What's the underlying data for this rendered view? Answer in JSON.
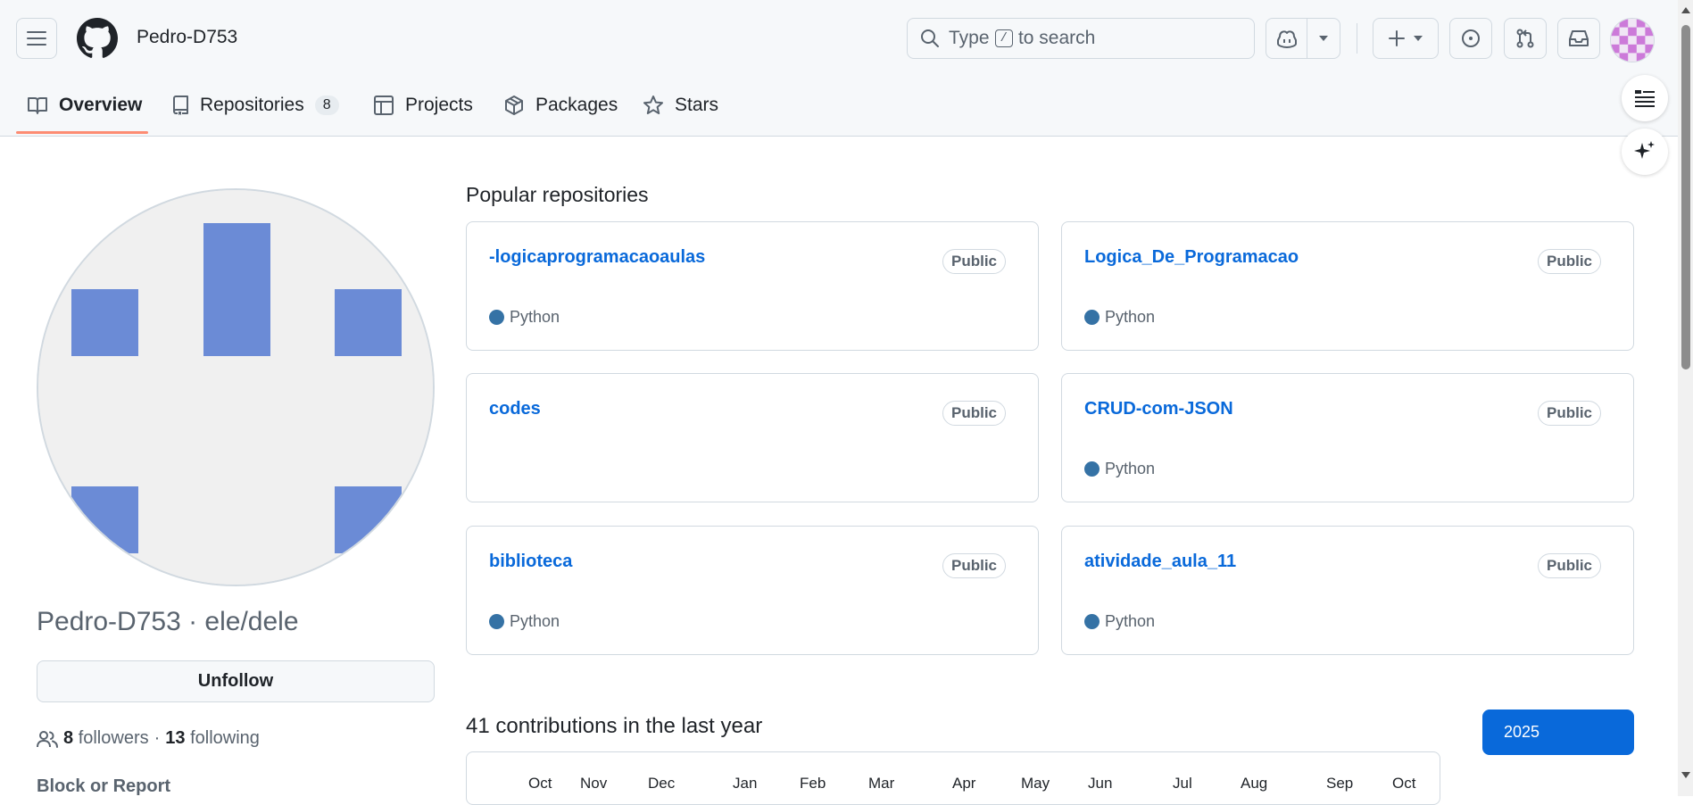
{
  "header": {
    "username": "Pedro-D753",
    "search": {
      "prefix": "Type",
      "key": "/",
      "suffix": "to search"
    }
  },
  "tabs": [
    {
      "label": "Overview",
      "icon": "book-icon",
      "active": true
    },
    {
      "label": "Repositories",
      "icon": "repo-icon",
      "count": "8"
    },
    {
      "label": "Projects",
      "icon": "table-icon"
    },
    {
      "label": "Packages",
      "icon": "package-icon"
    },
    {
      "label": "Stars",
      "icon": "star-icon"
    }
  ],
  "profile": {
    "name_line": "Pedro-D753 · ele/dele",
    "unfollow_label": "Unfollow",
    "followers_count": "8",
    "followers_label": "followers",
    "separator": "·",
    "following_count": "13",
    "following_label": "following",
    "block_report": "Block or Report"
  },
  "popular": {
    "title": "Popular repositories",
    "repos": [
      {
        "name": "-logicaprogramacaoaulas",
        "visibility": "Public",
        "language": "Python"
      },
      {
        "name": "Logica_De_Programacao",
        "visibility": "Public",
        "language": "Python"
      },
      {
        "name": "codes",
        "visibility": "Public",
        "language": ""
      },
      {
        "name": "CRUD-com-JSON",
        "visibility": "Public",
        "language": "Python"
      },
      {
        "name": "biblioteca",
        "visibility": "Public",
        "language": "Python"
      },
      {
        "name": "atividade_aula_11",
        "visibility": "Public",
        "language": "Python"
      }
    ]
  },
  "contributions": {
    "title": "41 contributions in the last year",
    "year": "2025",
    "months": [
      "Oct",
      "Nov",
      "Dec",
      "Jan",
      "Feb",
      "Mar",
      "Apr",
      "May",
      "Jun",
      "Jul",
      "Aug",
      "Sep",
      "Oct"
    ]
  },
  "colors": {
    "accent_link": "#0969da",
    "tab_underline": "#fd8c73",
    "python_dot": "#3572a5",
    "identicon": "#6b8bd6"
  }
}
